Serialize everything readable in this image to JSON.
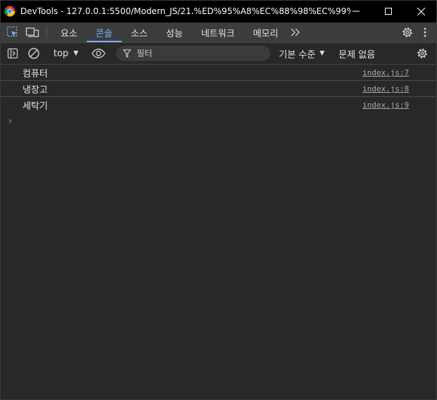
{
  "window": {
    "title": "DevTools - 127.0.0.1:5500/Modern_JS/21.%ED%95%A8%EC%88%98%EC%99%80_..."
  },
  "tabs": [
    {
      "label": "요소",
      "active": false
    },
    {
      "label": "콘솔",
      "active": true
    },
    {
      "label": "소스",
      "active": false
    },
    {
      "label": "성능",
      "active": false
    },
    {
      "label": "네트워크",
      "active": false
    },
    {
      "label": "메모리",
      "active": false
    }
  ],
  "toolbar": {
    "context": "top",
    "filter_placeholder": "필터",
    "levels": "기본 수준",
    "issues": "문제 없음"
  },
  "console": {
    "messages": [
      {
        "text": "컴퓨터",
        "source": "index.js:7"
      },
      {
        "text": "냉장고",
        "source": "index.js:8"
      },
      {
        "text": "세탁기",
        "source": "index.js:9"
      }
    ],
    "prompt": "›"
  },
  "colors": {
    "accent": "#7cacf8",
    "background": "#282828",
    "tabbar": "#3c3c3c",
    "titlebar": "#000000"
  }
}
